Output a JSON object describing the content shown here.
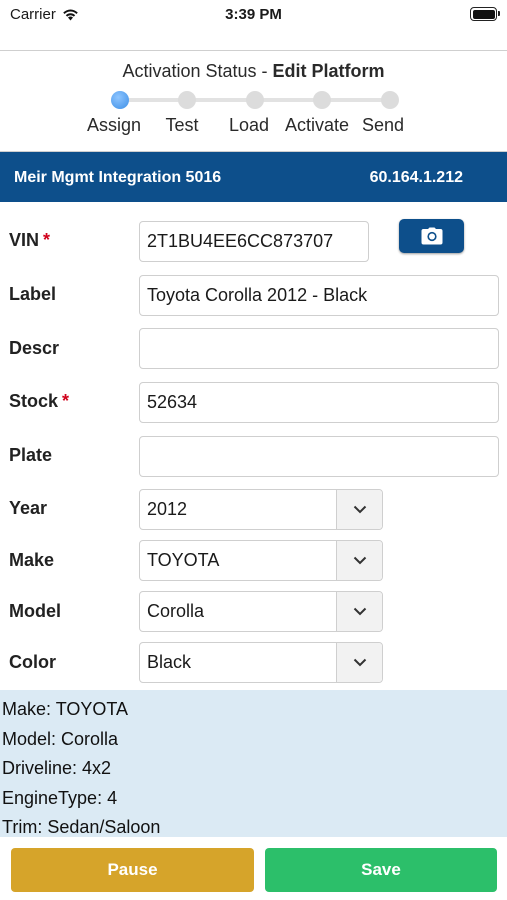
{
  "status_bar": {
    "carrier": "Carrier",
    "time": "3:39 PM"
  },
  "activation": {
    "title_prefix": "Activation Status - ",
    "title_bold": "Edit Platform",
    "steps": [
      "Assign",
      "Test",
      "Load",
      "Activate",
      "Send"
    ],
    "active_step": "Assign"
  },
  "integration": {
    "name": "Meir Mgmt Integration 5016",
    "ip": "60.164.1.212"
  },
  "form": {
    "vin": {
      "label": "VIN",
      "required_mark": "*",
      "value": "2T1BU4EE6CC873707"
    },
    "label": {
      "label": "Label",
      "value": "Toyota Corolla 2012 - Black"
    },
    "descr": {
      "label": "Descr",
      "value": ""
    },
    "stock": {
      "label": "Stock",
      "required_mark": "*",
      "value": "52634"
    },
    "plate": {
      "label": "Plate",
      "value": ""
    },
    "year": {
      "label": "Year",
      "value": "2012"
    },
    "make": {
      "label": "Make",
      "value": "TOYOTA"
    },
    "model": {
      "label": "Model",
      "value": "Corolla"
    },
    "color": {
      "label": "Color",
      "value": "Black"
    }
  },
  "info": {
    "make": "Make: TOYOTA",
    "model": "Model: Corolla",
    "driveline": "Driveline: 4x2",
    "engine_type": "EngineType: 4",
    "trim": "Trim: Sedan/Saloon"
  },
  "buttons": {
    "pause": "Pause",
    "save": "Save"
  },
  "colors": {
    "header_blue": "#0d4f8b",
    "pause_gold": "#d6a42a",
    "save_green": "#2cbf6a",
    "info_bg": "#dbeaf4",
    "required_red": "#d0021b"
  }
}
